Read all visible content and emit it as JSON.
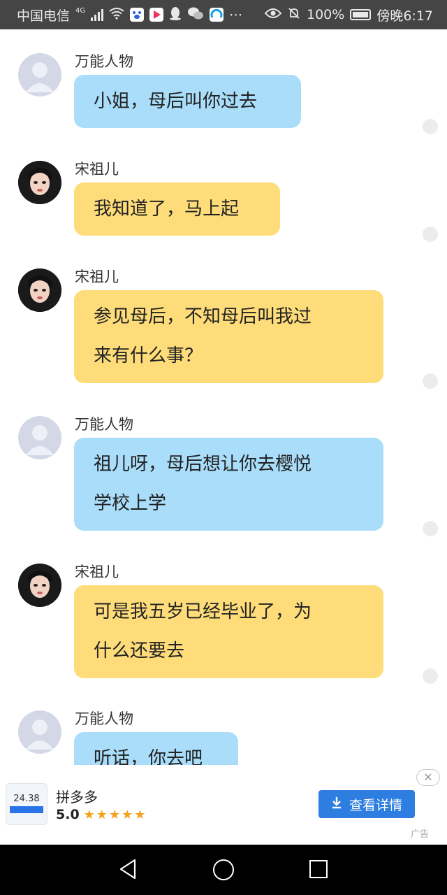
{
  "status_bar": {
    "carrier": "中国电信",
    "network": "4G",
    "battery": "100%",
    "time": "傍晚6:17"
  },
  "messages": [
    {
      "sender": "万能人物",
      "avatar": "default-avatar",
      "bubble_color": "blue",
      "text": "小姐，母后叫你过去"
    },
    {
      "sender": "宋祖儿",
      "avatar": "girl-avatar",
      "bubble_color": "yellow",
      "text": "我知道了，马上起"
    },
    {
      "sender": "宋祖儿",
      "avatar": "girl-avatar",
      "bubble_color": "yellow",
      "lines": [
        "参见母后，不知母后叫我过",
        "来有什么事？"
      ]
    },
    {
      "sender": "万能人物",
      "avatar": "default-avatar",
      "bubble_color": "blue",
      "lines": [
        "祖儿呀，母后想让你去樱悦",
        "学校上学"
      ]
    },
    {
      "sender": "宋祖儿",
      "avatar": "girl-avatar",
      "bubble_color": "yellow",
      "lines": [
        "可是我五岁已经毕业了，为",
        "什么还要去"
      ]
    },
    {
      "sender": "万能人物",
      "avatar": "default-avatar",
      "bubble_color": "blue",
      "text": "听话，你去吧"
    }
  ],
  "ad": {
    "thumb_value": "24.38",
    "app_name": "拼多多",
    "rating": "5.0",
    "stars": "★★★★★",
    "button_label": "查看详情",
    "close_glyph": "✕",
    "ad_label": "广告"
  },
  "colors": {
    "blue_bubble": "#a9ddfa",
    "yellow_bubble": "#fddc79",
    "ad_button": "#2d7ee0",
    "status_bar": "#454545"
  }
}
